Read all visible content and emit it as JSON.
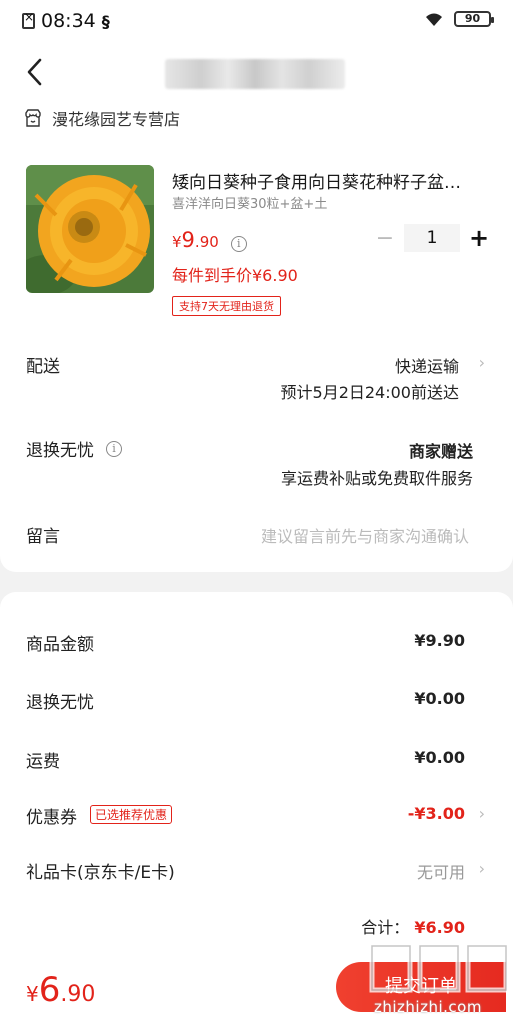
{
  "status_bar": {
    "time": "08:34",
    "battery": "90"
  },
  "store": {
    "name": "漫花缘园艺专营店"
  },
  "product": {
    "title": "矮向日葵种子食用向日葵花种籽子盆…",
    "spec": "喜洋洋向日葵30粒+盆+土",
    "price_currency": "¥",
    "price_int": "9",
    "price_dec": ".90",
    "quantity": "1",
    "unit_price": "每件到手价¥6.90",
    "return_badge": "支持7天无理由退货"
  },
  "delivery": {
    "label": "配送",
    "method": "快递运输",
    "eta": "预计5月2日24:00前送达"
  },
  "worry_free": {
    "label": "退换无忧",
    "value": "商家赠送",
    "desc": "享运费补贴或免费取件服务"
  },
  "message": {
    "label": "留言",
    "placeholder": "建议留言前先与商家沟通确认"
  },
  "summary": {
    "goods_label": "商品金额",
    "goods_value": "¥9.90",
    "return_label": "退换无忧",
    "return_value": "¥0.00",
    "shipping_label": "运费",
    "shipping_value": "¥0.00",
    "coupon_label": "优惠券",
    "coupon_badge": "已选推荐优惠",
    "coupon_value": "-¥3.00",
    "giftcard_label": "礼品卡(京东卡/E卡)",
    "giftcard_value": "无可用",
    "total_label": "合计：",
    "total_value": "¥6.90"
  },
  "bottom": {
    "currency": "¥",
    "int": "6",
    "dec": ".90",
    "submit_label": "提交订单",
    "watermark_text": "zhizhizhi.com"
  },
  "colors": {
    "accent": "#e2231a"
  }
}
